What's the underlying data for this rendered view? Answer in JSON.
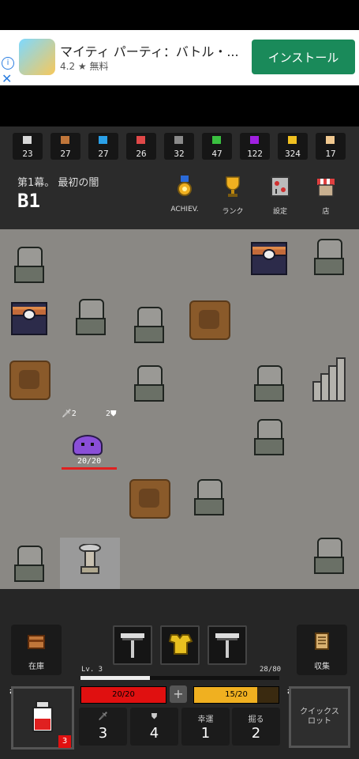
{
  "ad": {
    "title": "マイティ パーティ：バトル・...",
    "rating": "4.2 ★ 無料",
    "install_label": "インストール",
    "info_icon": "info-icon",
    "close_icon": "close-icon"
  },
  "resources": [
    {
      "icon": "stone-icon",
      "color": "#d8d8d8",
      "value": "23"
    },
    {
      "icon": "wood-icon",
      "color": "#c0763a",
      "value": "27"
    },
    {
      "icon": "water-orb-icon",
      "color": "#2aa0e8",
      "value": "27"
    },
    {
      "icon": "red-cloth-icon",
      "color": "#e04848",
      "value": "26"
    },
    {
      "icon": "iron-ore-icon",
      "color": "#8a8a8a",
      "value": "32"
    },
    {
      "icon": "herb-icon",
      "color": "#3ac040",
      "value": "47"
    },
    {
      "icon": "gem-icon",
      "color": "#a020e0",
      "value": "122"
    },
    {
      "icon": "gold-coin-icon",
      "color": "#f0c020",
      "value": "324"
    },
    {
      "icon": "scroll-icon",
      "color": "#f0c890",
      "value": "17"
    }
  ],
  "header": {
    "act_label": "第1幕。 最初の闇",
    "floor": "B1",
    "buttons": [
      {
        "icon": "medal-icon",
        "label": "ACHIEV."
      },
      {
        "icon": "trophy-icon",
        "label": "ランク"
      },
      {
        "icon": "settings-icon",
        "label": "設定"
      },
      {
        "icon": "shop-icon",
        "label": "店"
      }
    ]
  },
  "map": {
    "slime": {
      "attack": "2",
      "defense": "2",
      "hp": "20/20"
    }
  },
  "bottom": {
    "storage_label": "在庫",
    "collection_label": "収集",
    "level": "Lv.  3",
    "exp": "28/80",
    "exp_ratio": 0.35,
    "hp": "20/20",
    "sp": "15/20",
    "sp_ratio": 0.75,
    "stats": [
      {
        "icon": "sword-icon",
        "label": "",
        "value": "3"
      },
      {
        "icon": "shield-icon",
        "label": "",
        "value": "4"
      },
      {
        "icon": "",
        "label": "幸運",
        "value": "1"
      },
      {
        "icon": "",
        "label": "掘る",
        "value": "2"
      }
    ],
    "potion_count": "3",
    "quickslot_label": "クイックス\nロット"
  }
}
